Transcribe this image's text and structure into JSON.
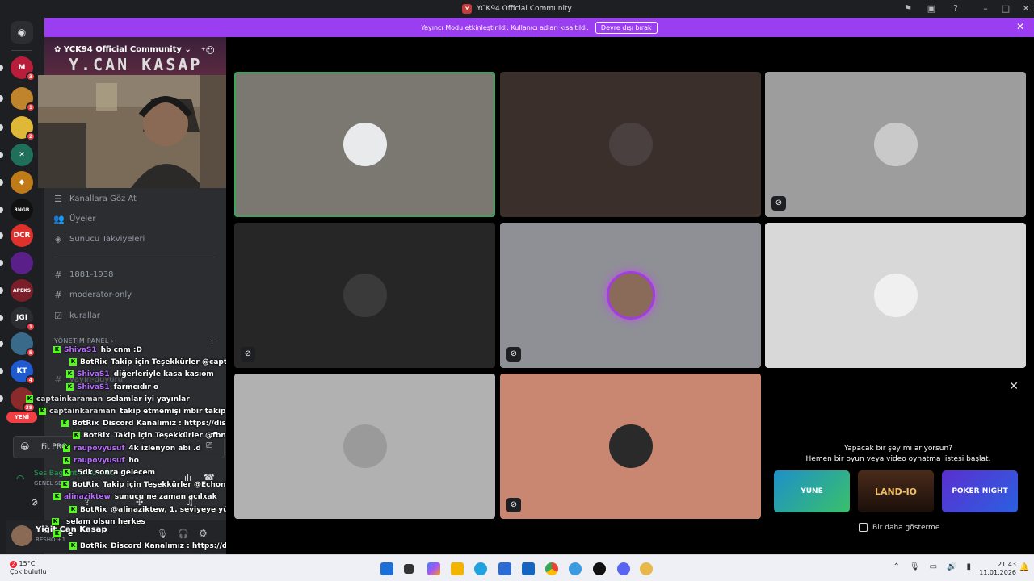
{
  "window": {
    "title": "YCK94 Official Community"
  },
  "banner": {
    "message": "Yayıncı Modu etkinleştirildi. Kullanıcı adları kısaltıldı.",
    "button": "Devre dışı bırak"
  },
  "guilds": [
    {
      "abbr": "M",
      "color": "#b81e3c",
      "badge": "3"
    },
    {
      "abbr": "",
      "color": "#c0842c",
      "badge": "1"
    },
    {
      "abbr": "",
      "color": "#e0b838",
      "badge": "2"
    },
    {
      "abbr": "✕",
      "color": "#1f6f5a",
      "badge": ""
    },
    {
      "abbr": "◆",
      "color": "#c07a18",
      "badge": ""
    },
    {
      "abbr": "3NGB",
      "color": "#111111",
      "badge": ""
    },
    {
      "abbr": "DCR",
      "color": "#e0322c",
      "badge": ""
    },
    {
      "abbr": "",
      "color": "#5b1f8a",
      "badge": ""
    },
    {
      "abbr": "APEKS",
      "color": "#7a1f2a",
      "badge": ""
    },
    {
      "abbr": "JGI",
      "color": "#2b2d31",
      "badge": "1"
    },
    {
      "abbr": "",
      "color": "#3a6a8a",
      "badge": "5"
    },
    {
      "abbr": "KT",
      "color": "#1f5ad0",
      "badge": "4"
    },
    {
      "abbr": "",
      "color": "#8a2a2a",
      "badge": "38"
    }
  ],
  "guild_new_label": "YENİ",
  "server": {
    "name": "YCK94 Official Community",
    "banner_text": "Y.CAN KASAP"
  },
  "channels": {
    "browse": "Kanallara Göz At",
    "members": "Üyeler",
    "boosts": "Sunucu Takviyeleri",
    "text": [
      "1881-1938",
      "moderator-only",
      "kurallar"
    ],
    "category": "YÖNETİM PANEL",
    "hidden1": "yayin-duyuru"
  },
  "chat": [
    {
      "user": "ShivaS1",
      "color": "#b76bff",
      "msg": "hb cnm :D"
    },
    {
      "user": "BotRix",
      "color": "#ffffff",
      "msg": "Takip için Teşekkürler @captainkaraman"
    },
    {
      "user": "ShivaS1",
      "color": "#b76bff",
      "msg": "diğerleriyle kasa kasıom"
    },
    {
      "user": "ShivaS1",
      "color": "#b76bff",
      "msg": "farmcıdır o"
    },
    {
      "user": "captainkaraman",
      "color": "#d9d9d9",
      "msg": "selamlar iyi yayınlar"
    },
    {
      "user": "captainkaraman",
      "color": "#d9d9d9",
      "msg": "takip etmemişi mbir takip edeyim dedim"
    },
    {
      "user": "BotRix",
      "color": "#ffffff",
      "msg": "Discord Kanalımız : https://discord.gg/xeB9JejQHk"
    },
    {
      "user": "BotRix",
      "color": "#ffffff",
      "msg": "Takip için Teşekkürler @fbnur"
    },
    {
      "user": "raupovyusuf",
      "color": "#b76bff",
      "msg": "4k izlenyon abi .d"
    },
    {
      "user": "raupovyusuf",
      "color": "#b76bff",
      "msg": "ho"
    },
    {
      "user": "",
      "color": "#ff5a5a",
      "msg": "5dk sonra gelecem"
    },
    {
      "user": "BotRix",
      "color": "#ffffff",
      "msg": "Takip için Teşekkürler @Echonico"
    },
    {
      "user": "alinaziktew",
      "color": "#b76bff",
      "msg": "sunucu ne zaman acılxak"
    },
    {
      "user": "BotRix",
      "color": "#ffffff",
      "msg": "@alinaziktew, 1. seviyeye yükseldin"
    },
    {
      "user": "",
      "color": "#ff5a5a",
      "msg": "selam olsun herkes"
    },
    {
      "user": "",
      "color": "#ff5a5a",
      "msg": "e"
    },
    {
      "user": "BotRix",
      "color": "#ffffff",
      "msg": "Discord Kanalımız : https://discord.gg/xeB9JejQHk"
    }
  ],
  "voice": {
    "status": "Ses Bağlantısı Kuruldu",
    "channel": "GENEL SES",
    "server_short": "Fit PRO"
  },
  "user": {
    "name": "Yiğit Can Kasap",
    "status": "RESHO +1"
  },
  "tiles": [
    {
      "bg": "#7b7872",
      "avatar_bg": "#e8eaec",
      "active": true,
      "muted": false,
      "ring": false
    },
    {
      "bg": "#3b2f2b",
      "avatar_bg": "#4a4040",
      "active": false,
      "muted": false,
      "ring": false
    },
    {
      "bg": "#9d9d9d",
      "avatar_bg": "#c9c9c9",
      "active": false,
      "muted": true,
      "ring": false
    },
    {
      "bg": "#262626",
      "avatar_bg": "#3a3a3a",
      "active": false,
      "muted": true,
      "ring": false
    },
    {
      "bg": "#8f8f96",
      "avatar_bg": "#8a6a58",
      "active": false,
      "muted": true,
      "ring": true
    },
    {
      "bg": "#d8d8d8",
      "avatar_bg": "#f0f0f0",
      "active": false,
      "muted": false,
      "ring": false
    },
    {
      "bg": "#b1b1b1",
      "avatar_bg": "#9a9a9a",
      "active": false,
      "muted": false,
      "ring": false
    },
    {
      "bg": "#c98670",
      "avatar_bg": "#2a2a2a",
      "active": false,
      "muted": true,
      "ring": false
    }
  ],
  "promo": {
    "line1": "Yapacak bir şey mi arıyorsun?",
    "line2": "Hemen bir oyun veya video oynatma listesi başlat.",
    "activities": [
      "YUNE",
      "LAND-IO",
      "POKER NIGHT"
    ],
    "dont_show": "Bir daha gösterme"
  },
  "taskbar": {
    "temp": "15°C",
    "weather": "Çok bulutlu",
    "time": "21:43",
    "date": "11.01.2026",
    "weather_badge": "2"
  }
}
